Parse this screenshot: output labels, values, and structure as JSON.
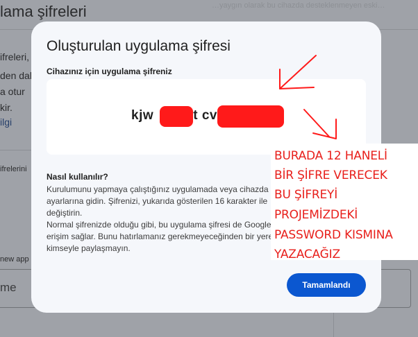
{
  "background": {
    "title": "lama şifreleri",
    "faint_text": "…yaygın olarak bu cihazda desteklenmeyen eski…",
    "lines": [
      "ifreleri,",
      "den dal",
      "a otur",
      "kir."
    ],
    "link": "ilgi",
    "list_label": "ifrelerini",
    "new_app_label": "new app",
    "field_text": "me"
  },
  "dialog": {
    "title": "Oluşturulan uygulama şifresi",
    "password_label": "Cihazınız için uygulama şifreniz",
    "password_fragments": [
      "kjw",
      "yt cv"
    ],
    "howto_title": "Nasıl kullanılır?",
    "howto_lines": [
      "Kurulumunu yapmaya çalıştığınız uygulamada veya cihazda",
      "ayarlarına gidin. Şifrenizi, yukarıda gösterilen 16 karakter ile",
      "değiştirin.",
      "Normal şifrenizde olduğu gibi, bu uygulama şifresi de Google",
      "erişim sağlar. Bunu hatırlamanız gerekmeyeceğinden bir yere",
      "kimseyle paylaşmayın."
    ],
    "done_label": "Tamamlandı"
  },
  "annotation": {
    "lines": [
      "BURADA 12 HANELİ",
      "BİR ŞİFRE VERECEK",
      "BU ŞİFREYİ",
      "PROJEMİZDEKİ",
      "PASSWORD KISMINA",
      "YAZACAĞIZ"
    ],
    "color": "#e8201c"
  },
  "colors": {
    "overlay": "#9fa2a8",
    "dialog_bg": "#f5f7fb",
    "button": "#0b57d0",
    "redaction": "#ff1a1a"
  }
}
